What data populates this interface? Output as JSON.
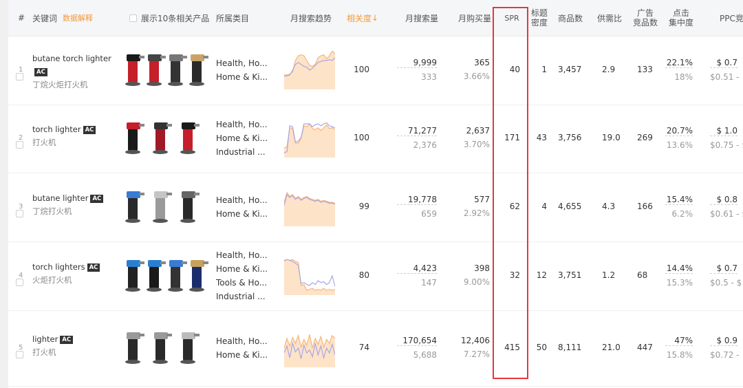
{
  "header": {
    "index": "#",
    "keyword": "关键词",
    "keyword_link": "数据解释",
    "show_products": "展示10条相关产品",
    "category": "所属类目",
    "trend": "月搜索趋势",
    "relevance": "相关度",
    "relevance_sort": "↓",
    "monthly_search": "月搜索量",
    "monthly_purchase": "月购买量",
    "spr": "SPR",
    "title_density_1": "标题",
    "title_density_2": "密度",
    "products_count": "商品数",
    "supply_demand": "供需比",
    "ad_products_1": "广告",
    "ad_products_2": "竞品数",
    "click_concentration_1": "点击",
    "click_concentration_2": "集中度",
    "ppc": "PPC竞"
  },
  "rows": [
    {
      "index": "1",
      "keyword": "butane torch lighter",
      "ac": "AC",
      "keyword_cn": "丁烷火炬打火机",
      "categories": [
        "Health, Ho...",
        "Home & Ki..."
      ],
      "relevance": "100",
      "monthly_search": "9,999",
      "monthly_search_sub": "333",
      "monthly_purchase": "365",
      "monthly_purchase_sub": "3.66%",
      "spr": "40",
      "title_density": "1",
      "products_count": "3,457",
      "supply_demand": "2.9",
      "ad_products": "133",
      "click_concentration": "22.1%",
      "click_concentration_sub": "18%",
      "ppc": "$ 0.7",
      "ppc_sub": "$0.51 -"
    },
    {
      "index": "2",
      "keyword": "torch lighter",
      "ac": "AC",
      "keyword_cn": "打火机",
      "categories": [
        "Health, Ho...",
        "Home & Ki...",
        "Industrial ..."
      ],
      "relevance": "100",
      "monthly_search": "71,277",
      "monthly_search_sub": "2,376",
      "monthly_purchase": "2,637",
      "monthly_purchase_sub": "3.70%",
      "spr": "171",
      "title_density": "43",
      "products_count": "3,756",
      "supply_demand": "19.0",
      "ad_products": "269",
      "click_concentration": "20.7%",
      "click_concentration_sub": "13.6%",
      "ppc": "$ 1.0",
      "ppc_sub": "$0.75 - $"
    },
    {
      "index": "3",
      "keyword": "butane lighter",
      "ac": "AC",
      "keyword_cn": "丁烷打火机",
      "categories": [
        "Health, Ho...",
        "Home & Ki..."
      ],
      "relevance": "99",
      "monthly_search": "19,778",
      "monthly_search_sub": "659",
      "monthly_purchase": "577",
      "monthly_purchase_sub": "2.92%",
      "spr": "62",
      "title_density": "4",
      "products_count": "4,655",
      "supply_demand": "4.3",
      "ad_products": "166",
      "click_concentration": "15.4%",
      "click_concentration_sub": "6.2%",
      "ppc": "$ 0.8",
      "ppc_sub": "$0.61 - $"
    },
    {
      "index": "4",
      "keyword": "torch lighters",
      "ac": "AC",
      "keyword_cn": "火炬打火机",
      "categories": [
        "Health, Ho...",
        "Home & Ki...",
        "Tools & Ho...",
        "Industrial ..."
      ],
      "relevance": "80",
      "monthly_search": "4,423",
      "monthly_search_sub": "147",
      "monthly_purchase": "398",
      "monthly_purchase_sub": "9.00%",
      "spr": "32",
      "title_density": "12",
      "products_count": "3,751",
      "supply_demand": "1.2",
      "ad_products": "68",
      "click_concentration": "14.4%",
      "click_concentration_sub": "15.3%",
      "ppc": "$ 0.7",
      "ppc_sub": "$0.5 - $"
    },
    {
      "index": "5",
      "keyword": "lighter",
      "ac": "AC",
      "keyword_cn": "打火机",
      "categories": [
        "Health, Ho...",
        "Home & Ki..."
      ],
      "relevance": "74",
      "monthly_search": "170,654",
      "monthly_search_sub": "5,688",
      "monthly_purchase": "12,406",
      "monthly_purchase_sub": "7.27%",
      "spr": "415",
      "title_density": "50",
      "products_count": "8,111",
      "supply_demand": "21.0",
      "ad_products": "447",
      "click_concentration": "47%",
      "click_concentration_sub": "15.8%",
      "ppc": "$ 0.9",
      "ppc_sub": "$0.72 -"
    }
  ],
  "colors": {
    "highlight_border": "#e5373a",
    "accent_orange": "#f39a3a",
    "trend_fill": "#fde3c8",
    "trend_line_orange": "#f6b57a",
    "trend_line_purple": "#a9a6e8"
  }
}
